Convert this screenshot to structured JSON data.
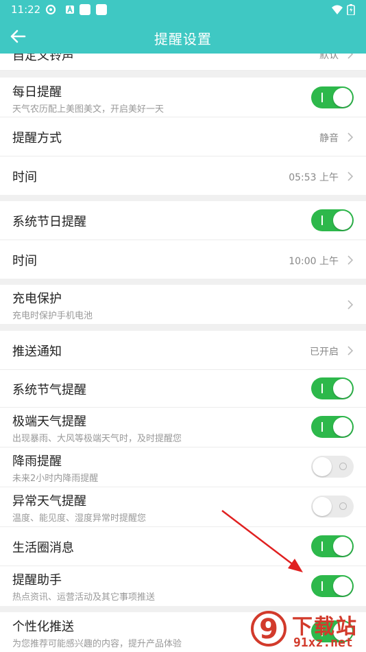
{
  "status_bar": {
    "time": "11:22"
  },
  "app_bar": {
    "title": "提醒设置"
  },
  "partial_row": {
    "label": "自定义铃声",
    "value": "默认"
  },
  "daily": {
    "label": "每日提醒",
    "sub": "天气农历配上美图美文，开启美好一天",
    "enabled": true
  },
  "mode": {
    "label": "提醒方式",
    "value": "静音"
  },
  "daily_time": {
    "label": "时间",
    "value": "05:53 上午"
  },
  "festival": {
    "label": "系统节日提醒",
    "enabled": true
  },
  "festival_time": {
    "label": "时间",
    "value": "10:00 上午"
  },
  "charging": {
    "label": "充电保护",
    "sub": "充电时保护手机电池"
  },
  "push": {
    "label": "推送通知",
    "value": "已开启"
  },
  "solar_terms": {
    "label": "系统节气提醒",
    "enabled": true
  },
  "extreme": {
    "label": "极端天气提醒",
    "sub": "出现暴雨、大风等极端天气时，及时提醒您",
    "enabled": true
  },
  "rain": {
    "label": "降雨提醒",
    "sub": "未来2小时内降雨提醒",
    "enabled": false
  },
  "abnormal": {
    "label": "异常天气提醒",
    "sub": "温度、能见度、湿度异常时提醒您",
    "enabled": false
  },
  "life_circle": {
    "label": "生活圈消息",
    "enabled": true
  },
  "assistant": {
    "label": "提醒助手",
    "sub": "热点资讯、运营活动及其它事项推送",
    "enabled": true
  },
  "personalized": {
    "label": "个性化推送",
    "sub": "为您推荐可能感兴趣的内容，提升产品体验",
    "enabled": true
  },
  "watermark": {
    "brand": "下载站",
    "url": "91xz.net",
    "logo_text": "9"
  },
  "colors": {
    "accent": "#3fc8c3",
    "toggle_on": "#2db84b",
    "annotation": "#e02020"
  }
}
